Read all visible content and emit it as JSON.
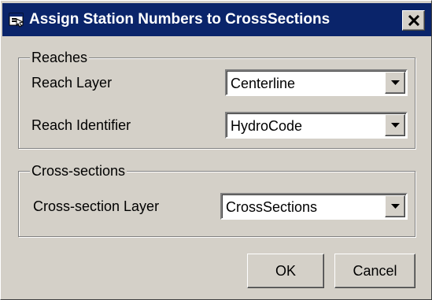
{
  "window": {
    "title": "Assign Station Numbers to CrossSections",
    "title_icon": "window-app-icon",
    "close_icon": "close-x-icon",
    "colors": {
      "titlebar": "#0a246a",
      "face": "#d4d0c8"
    }
  },
  "reaches": {
    "legend": "Reaches",
    "reach_layer": {
      "label": "Reach Layer",
      "value": "Centerline"
    },
    "reach_identifier": {
      "label": "Reach Identifier",
      "value": "HydroCode"
    }
  },
  "cross_sections": {
    "legend": "Cross-sections",
    "layer": {
      "label": "Cross-section Layer",
      "value": "CrossSections"
    }
  },
  "buttons": {
    "ok": "OK",
    "cancel": "Cancel"
  },
  "dropdown_icon": "chevron-down-icon"
}
